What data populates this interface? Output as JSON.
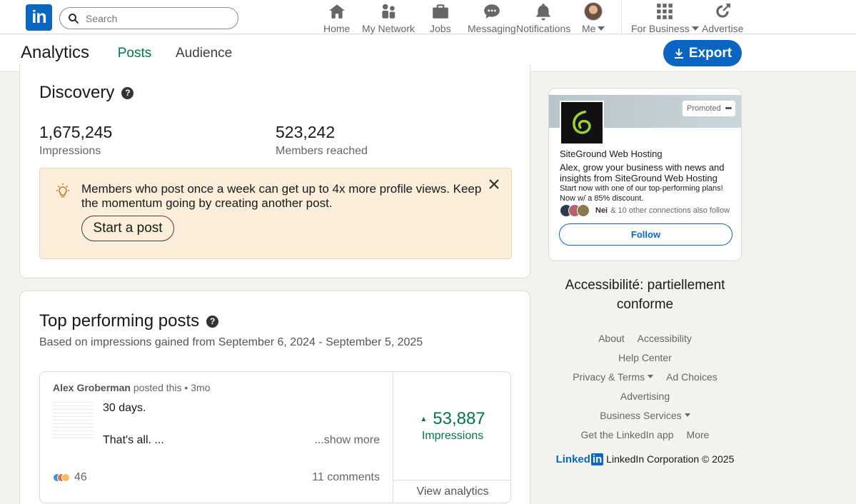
{
  "nav": {
    "logo": "in",
    "search_placeholder": "Search",
    "items": [
      {
        "label": "Home",
        "icon": "home-icon"
      },
      {
        "label": "My Network",
        "icon": "network-icon"
      },
      {
        "label": "Jobs",
        "icon": "briefcase-icon"
      },
      {
        "label": "Messaging",
        "icon": "messaging-icon"
      },
      {
        "label": "Notifications",
        "icon": "bell-icon"
      },
      {
        "label": "Me",
        "icon": "avatar"
      },
      {
        "label": "For Business",
        "icon": "grid-icon"
      },
      {
        "label": "Advertise",
        "icon": "advertise-icon"
      }
    ]
  },
  "subheader": {
    "title": "Analytics",
    "tabs": [
      "Posts",
      "Audience"
    ],
    "active_tab": "Posts",
    "export_label": "Export"
  },
  "discovery": {
    "title": "Discovery",
    "help": "?",
    "impressions_value": "1,675,245",
    "impressions_label": "Impressions",
    "reached_value": "523,242",
    "reached_label": "Members reached",
    "tip_text": "Members who post once a week can get up to 4x more profile views. Keep the momentum going by creating another post.",
    "start_post_label": "Start a post"
  },
  "top_posts": {
    "title": "Top performing posts",
    "help": "?",
    "subtitle": "Based on impressions gained from September 6, 2024 - September 5, 2025",
    "post": {
      "author": "Alex Groberman",
      "meta": "posted this • 3mo",
      "line1": "30 days.",
      "line2": "That's all. ...",
      "show_more": "...show more",
      "reactions": "46",
      "comments": "11 comments",
      "impressions_value": "53,887",
      "impressions_label": "Impressions",
      "trend_symbol": "▲",
      "view_analytics": "View analytics"
    }
  },
  "ad": {
    "promoted": "Promoted",
    "more": "•••",
    "name": "SiteGround Web Hosting",
    "text": "Alex, grow your business with news and insights from SiteGround Web Hosting",
    "small": "Start now with one of our top-performing plans! Now w/ a 85% discount.",
    "connection_name": "Nei",
    "connection_text": "& 10 other connections also follow",
    "follow_label": "Follow"
  },
  "footer": {
    "accessibility_note": "Accessibilité: partiellement conforme",
    "about": "About",
    "accessibility": "Accessibility",
    "help_center": "Help Center",
    "privacy_terms": "Privacy & Terms",
    "ad_choices": "Ad Choices",
    "advertising": "Advertising",
    "business_services": "Business Services",
    "get_app": "Get the LinkedIn app",
    "more": "More",
    "logo_text": "Linked",
    "logo_in": "in",
    "copyright": "LinkedIn Corporation © 2025"
  },
  "colors": {
    "brand_blue": "#0a66c2",
    "accent_green": "#01754f",
    "tip_bg": "#fbeedb",
    "page_bg": "#f4f2ee"
  }
}
